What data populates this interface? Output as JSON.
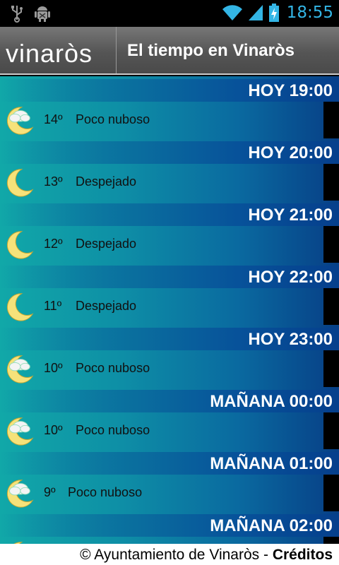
{
  "status_bar": {
    "time": "18:55",
    "icons": [
      "usb-icon",
      "android-debug-icon",
      "wifi-icon",
      "signal-icon",
      "battery-charging-icon"
    ]
  },
  "header": {
    "logo_text": "VINARÒS",
    "title": "El tiempo en Vinaròs"
  },
  "forecast": [
    {
      "time": "HOY 19:00",
      "temp": "14º",
      "desc": "Poco nuboso",
      "icon": "moon-cloud-icon"
    },
    {
      "time": "HOY 20:00",
      "temp": "13º",
      "desc": "Despejado",
      "icon": "moon-icon"
    },
    {
      "time": "HOY 21:00",
      "temp": "12º",
      "desc": "Despejado",
      "icon": "moon-icon"
    },
    {
      "time": "HOY 22:00",
      "temp": "11º",
      "desc": "Despejado",
      "icon": "moon-icon"
    },
    {
      "time": "HOY 23:00",
      "temp": "10º",
      "desc": "Poco nuboso",
      "icon": "moon-cloud-icon"
    },
    {
      "time": "MAÑANA 00:00",
      "temp": "10º",
      "desc": "Poco nuboso",
      "icon": "moon-cloud-icon"
    },
    {
      "time": "MAÑANA 01:00",
      "temp": "9º",
      "desc": "Poco nuboso",
      "icon": "moon-cloud-icon"
    },
    {
      "time": "MAÑANA 02:00",
      "temp": "",
      "desc": "",
      "icon": "moon-cloud-icon"
    }
  ],
  "footer": {
    "copyright": "© Ayuntamiento de Vinaròs - ",
    "credits": "Créditos"
  },
  "colors": {
    "accent": "#33b5e5",
    "list_teal": "#11a8a8",
    "list_blue": "#073f86",
    "moon": "#f6e27a"
  }
}
